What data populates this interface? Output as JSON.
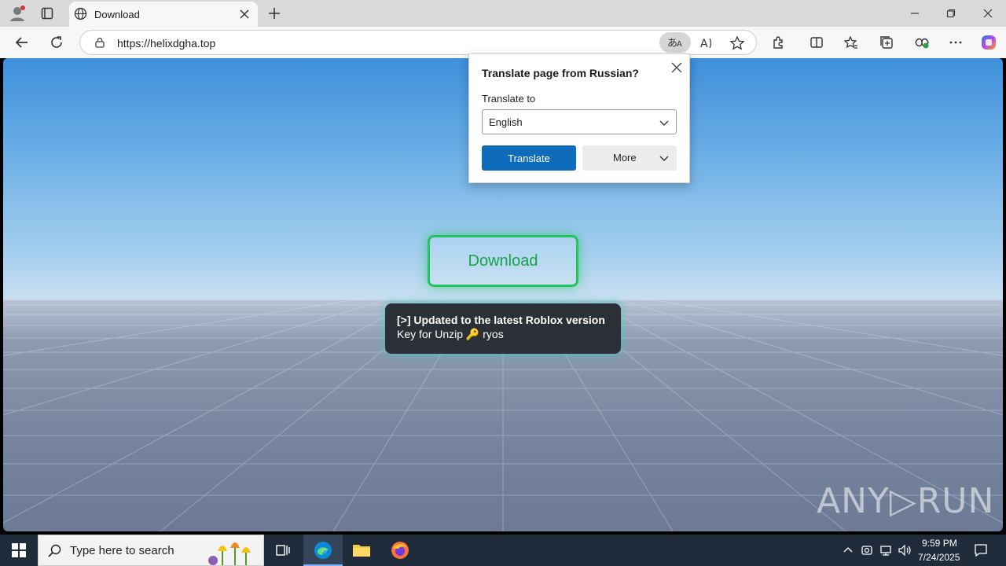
{
  "browser": {
    "tab_title": "Download",
    "url": "https://helixdgha.top"
  },
  "page": {
    "download_label": "Download",
    "note_line1": "[>] Updated to the latest Roblox version",
    "note_line2": "Key for Unzip 🔑 ryos",
    "watermark": "ANY▷RUN"
  },
  "translate_popup": {
    "title": "Translate page from Russian?",
    "label": "Translate to",
    "selected_language": "English",
    "translate_label": "Translate",
    "more_label": "More"
  },
  "taskbar": {
    "search_placeholder": "Type here to search",
    "time": "9:59 PM",
    "date": "7/24/2025"
  },
  "colors": {
    "accent": "#0f6cbd",
    "download_green": "#22c55e",
    "taskbar": "#1f2a3a"
  },
  "icons": [
    "profile-icon",
    "tab-actions-icon",
    "globe-icon",
    "close-icon",
    "new-tab-icon",
    "back-icon",
    "refresh-icon",
    "lock-icon",
    "translate-icon",
    "read-aloud-icon",
    "favorite-star-icon",
    "extensions-icon",
    "split-screen-icon",
    "favorites-icon",
    "collections-icon",
    "browser-essentials-icon",
    "more-icon",
    "copilot-icon",
    "windows-start-icon",
    "search-icon",
    "task-view-icon",
    "edge-icon",
    "file-explorer-icon",
    "firefox-icon",
    "chevron-up-icon",
    "network-icon",
    "volume-icon",
    "notification-icon"
  ]
}
